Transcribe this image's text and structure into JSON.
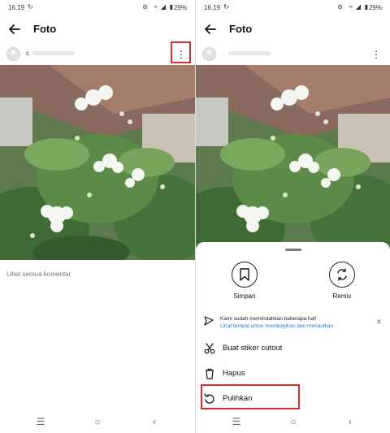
{
  "left": {
    "status": {
      "time": "16.19",
      "battery": "29%"
    },
    "header": {
      "title": "Foto"
    },
    "post": {
      "username": "c"
    },
    "comments": {
      "link": "Lihat semua komentar"
    }
  },
  "right": {
    "status": {
      "time": "16.19",
      "battery": "29%"
    },
    "header": {
      "title": "Foto"
    },
    "post": {
      "username": "..."
    },
    "sheet": {
      "actions": [
        {
          "label": "Simpan",
          "icon": "bookmark-icon"
        },
        {
          "label": "Remix",
          "icon": "remix-icon"
        }
      ],
      "notice": {
        "text": "Kami sudah memindahkan beberapa hal!",
        "link": "Lihat tempat untuk membagikan dan menautkan"
      },
      "menu": [
        {
          "label": "Buat stiker cutout",
          "icon": "scissors-icon"
        },
        {
          "label": "Hapus",
          "icon": "trash-icon"
        },
        {
          "label": "Pulihkan",
          "icon": "restore-icon"
        }
      ]
    }
  },
  "colors": {
    "highlight": "#d32f2f",
    "link": "#1f7ae0"
  }
}
